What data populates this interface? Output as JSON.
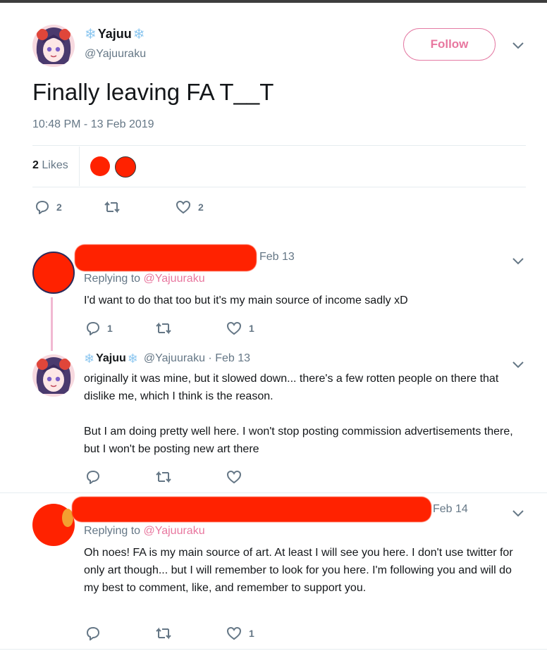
{
  "author": {
    "display_name": "Yajuu",
    "handle": "@Yajuuraku",
    "snowflake": "❄"
  },
  "follow_label": "Follow",
  "tweet": {
    "text": "Finally leaving FA T__T",
    "timestamp": "10:48 PM - 13 Feb 2019",
    "likes_count": "2",
    "likes_label": "Likes",
    "reply_count": "2",
    "like_count": "2"
  },
  "replies": [
    {
      "date": "Feb 13",
      "replying_prefix": "Replying to",
      "replying_to": "@Yajuuraku",
      "text": "I'd want to do that too but it's my main source of income sadly xD",
      "reply_count": "1",
      "like_count": "1"
    },
    {
      "display_name": "Yajuu",
      "handle_date": "@Yajuuraku · Feb 13",
      "paragraphs": [
        "originally it was mine, but it slowed down... there's a few rotten people on there that dislike me, which I think is the reason.",
        "But I am doing pretty well here. I won't stop posting commission advertisements there, but I won't be posting new art there"
      ]
    },
    {
      "date": "Feb 14",
      "replying_prefix": "Replying to",
      "replying_to": "@Yajuuraku",
      "text": "Oh noes! FA is my main source of art. At least I will see you here. I don't use twitter for only art though... but I will remember to look for you here. I'm following you and will do my best to comment, like, and remember to support you.",
      "like_count": "1"
    }
  ],
  "colors": {
    "accent": "#e8779f",
    "redaction": "#ff2200",
    "muted": "#657786",
    "thread_line": "#f1b8d2"
  },
  "icons": [
    "reply-icon",
    "retweet-icon",
    "like-icon",
    "chevron-down-icon",
    "snowflake-icon"
  ]
}
